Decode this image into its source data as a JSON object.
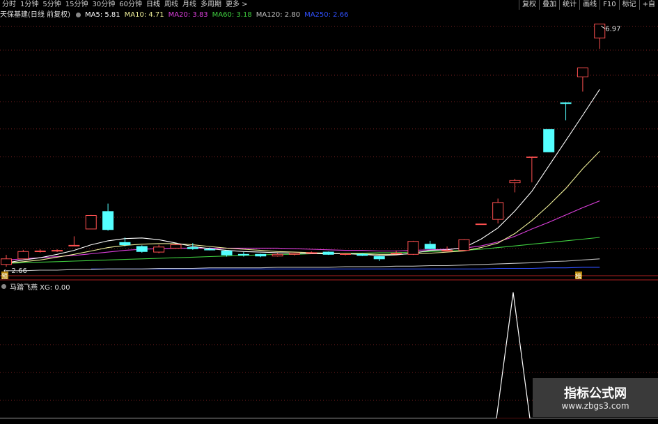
{
  "toolbar": {
    "periods": [
      "分时",
      "1分钟",
      "5分钟",
      "15分钟",
      "30分钟",
      "60分钟",
      "日线",
      "周线",
      "月线",
      "多周期",
      "更多 >"
    ],
    "active_period": "日线",
    "tools": [
      "复权",
      "叠加",
      "统计",
      "画线",
      "F10",
      "标记",
      "+自"
    ]
  },
  "legend": {
    "title": "天保基建(日线 前复权)",
    "ma5": "MA5: 5.81",
    "ma10": "MA10: 4.71",
    "ma20": "MA20: 3.83",
    "ma60": "MA60: 3.18",
    "ma120": "MA120: 2.80",
    "ma250": "MA250: 2.66"
  },
  "colors": {
    "ma5": "#ffffff",
    "ma10": "#f0f09a",
    "ma20": "#e040e0",
    "ma60": "#40d040",
    "ma120": "#c0c0c0",
    "ma250": "#3050ff",
    "up": "#ff5050",
    "down": "#54ffff",
    "grid": "#7a1f1f",
    "axis": "#b02020",
    "ind": "#ffffff"
  },
  "annotations": {
    "high_price": "6.97",
    "low_price": "2.66",
    "yu_badge": "预",
    "buy_badge": "榜"
  },
  "indicator": {
    "legend": "马踏飞燕 XG: 0.00",
    "xg_values": [
      0,
      0,
      0,
      0,
      0,
      0,
      0,
      0,
      0,
      0,
      0,
      0,
      0,
      0,
      0,
      0,
      0,
      0,
      0,
      0,
      0,
      0,
      0,
      0,
      0,
      0,
      0,
      0,
      0,
      0,
      1,
      0,
      0,
      0,
      0
    ]
  },
  "chart_data": {
    "type": "candlestick",
    "title": "天保基建(日线 前复权)",
    "ohlc": [
      {
        "o": 2.7,
        "c": 2.8,
        "h": 2.87,
        "l": 2.66
      },
      {
        "o": 2.8,
        "c": 2.93,
        "h": 2.96,
        "l": 2.8
      },
      {
        "o": 2.93,
        "c": 2.94,
        "h": 2.97,
        "l": 2.91
      },
      {
        "o": 2.94,
        "c": 2.95,
        "h": 2.97,
        "l": 2.92
      },
      {
        "o": 3.03,
        "c": 3.04,
        "h": 3.2,
        "l": 3.02
      },
      {
        "o": 3.33,
        "c": 3.57,
        "h": 3.58,
        "l": 3.33
      },
      {
        "o": 3.64,
        "c": 3.32,
        "h": 3.78,
        "l": 3.3
      },
      {
        "o": 3.09,
        "c": 3.05,
        "h": 3.18,
        "l": 3.02
      },
      {
        "o": 3.02,
        "c": 2.93,
        "h": 3.04,
        "l": 2.91
      },
      {
        "o": 2.92,
        "c": 3.01,
        "h": 3.05,
        "l": 2.9
      },
      {
        "o": 2.99,
        "c": 3.05,
        "h": 3.06,
        "l": 2.98
      },
      {
        "o": 3.0,
        "c": 2.98,
        "h": 3.08,
        "l": 2.96
      },
      {
        "o": 2.97,
        "c": 2.96,
        "h": 3.0,
        "l": 2.95
      },
      {
        "o": 2.94,
        "c": 2.87,
        "h": 2.95,
        "l": 2.84
      },
      {
        "o": 2.88,
        "c": 2.87,
        "h": 2.92,
        "l": 2.84
      },
      {
        "o": 2.88,
        "c": 2.85,
        "h": 2.89,
        "l": 2.83
      },
      {
        "o": 2.85,
        "c": 2.88,
        "h": 2.9,
        "l": 2.84
      },
      {
        "o": 2.88,
        "c": 2.9,
        "h": 2.91,
        "l": 2.86
      },
      {
        "o": 2.9,
        "c": 2.91,
        "h": 2.93,
        "l": 2.89
      },
      {
        "o": 2.92,
        "c": 2.88,
        "h": 2.93,
        "l": 2.87
      },
      {
        "o": 2.89,
        "c": 2.89,
        "h": 2.9,
        "l": 2.86
      },
      {
        "o": 2.88,
        "c": 2.86,
        "h": 2.9,
        "l": 2.85
      },
      {
        "o": 2.84,
        "c": 2.8,
        "h": 2.85,
        "l": 2.76
      },
      {
        "o": 2.89,
        "c": 2.9,
        "h": 2.95,
        "l": 2.88
      },
      {
        "o": 2.88,
        "c": 3.11,
        "h": 3.12,
        "l": 2.87
      },
      {
        "o": 3.06,
        "c": 2.98,
        "h": 3.12,
        "l": 2.97
      },
      {
        "o": 2.94,
        "c": 2.95,
        "h": 3.02,
        "l": 2.94
      },
      {
        "o": 2.95,
        "c": 3.14,
        "h": 3.15,
        "l": 2.94
      },
      {
        "o": 3.42,
        "c": 3.42,
        "h": 3.42,
        "l": 3.42
      },
      {
        "o": 3.5,
        "c": 3.8,
        "h": 3.87,
        "l": 3.43
      },
      {
        "o": 4.15,
        "c": 4.19,
        "h": 4.22,
        "l": 3.98
      },
      {
        "o": 4.6,
        "c": 4.61,
        "h": 4.61,
        "l": 4.16
      },
      {
        "o": 5.1,
        "c": 4.7,
        "h": 5.1,
        "l": 4.7
      },
      {
        "o": 5.57,
        "c": 5.56,
        "h": 5.58,
        "l": 5.26
      },
      {
        "o": 6.03,
        "c": 6.19,
        "h": 6.19,
        "l": 5.77
      },
      {
        "o": 6.72,
        "c": 6.97,
        "h": 6.97,
        "l": 6.53
      }
    ],
    "ma_lines": {
      "ma5": {
        "start": 0,
        "values": [
          2.73,
          2.78,
          2.82,
          2.88,
          2.95,
          3.05,
          3.12,
          3.16,
          3.17,
          3.14,
          3.08,
          3.02,
          2.98,
          2.95,
          2.93,
          2.92,
          2.91,
          2.9,
          2.89,
          2.89,
          2.89,
          2.88,
          2.86,
          2.87,
          2.9,
          2.95,
          2.96,
          3.0,
          3.15,
          3.35,
          3.65,
          4.0,
          4.45,
          4.9,
          5.35,
          5.81
        ]
      },
      "ma10": {
        "start": 0,
        "values": [
          2.72,
          2.75,
          2.78,
          2.83,
          2.88,
          2.94,
          3.0,
          3.04,
          3.06,
          3.07,
          3.07,
          3.05,
          3.02,
          2.99,
          2.97,
          2.95,
          2.93,
          2.92,
          2.91,
          2.9,
          2.89,
          2.89,
          2.88,
          2.88,
          2.89,
          2.9,
          2.92,
          2.94,
          3.0,
          3.08,
          3.25,
          3.48,
          3.75,
          4.05,
          4.4,
          4.71
        ]
      },
      "ma20": {
        "start": 0,
        "values": [
          2.78,
          2.8,
          2.82,
          2.84,
          2.86,
          2.89,
          2.92,
          2.95,
          2.97,
          2.98,
          2.99,
          2.99,
          2.99,
          2.99,
          2.99,
          2.99,
          2.99,
          2.98,
          2.97,
          2.96,
          2.95,
          2.95,
          2.94,
          2.94,
          2.95,
          2.96,
          2.97,
          2.99,
          3.03,
          3.1,
          3.2,
          3.33,
          3.45,
          3.58,
          3.71,
          3.83
        ]
      },
      "ma60": {
        "start": 0,
        "values": [
          2.72,
          2.73,
          2.74,
          2.75,
          2.76,
          2.77,
          2.78,
          2.79,
          2.8,
          2.81,
          2.82,
          2.83,
          2.84,
          2.85,
          2.86,
          2.87,
          2.88,
          2.88,
          2.89,
          2.89,
          2.9,
          2.9,
          2.91,
          2.91,
          2.92,
          2.93,
          2.94,
          2.95,
          2.97,
          3.0,
          3.03,
          3.06,
          3.09,
          3.12,
          3.15,
          3.18
        ]
      },
      "ma120": {
        "start": 0,
        "values": [
          2.59,
          2.59,
          2.6,
          2.6,
          2.61,
          2.61,
          2.62,
          2.62,
          2.62,
          2.63,
          2.63,
          2.63,
          2.64,
          2.64,
          2.64,
          2.64,
          2.65,
          2.65,
          2.65,
          2.65,
          2.66,
          2.66,
          2.66,
          2.67,
          2.67,
          2.68,
          2.68,
          2.69,
          2.7,
          2.71,
          2.72,
          2.73,
          2.75,
          2.76,
          2.78,
          2.8
        ]
      },
      "ma250": {
        "start": 5,
        "values": [
          2.62,
          2.62,
          2.62,
          2.62,
          2.62,
          2.62,
          2.62,
          2.62,
          2.62,
          2.62,
          2.62,
          2.62,
          2.62,
          2.62,
          2.62,
          2.62,
          2.62,
          2.62,
          2.62,
          2.62,
          2.62,
          2.62,
          2.62,
          2.62,
          2.63,
          2.63,
          2.63,
          2.64,
          2.64,
          2.65,
          2.65
        ]
      }
    },
    "ylim": [
      2.55,
      7.05
    ],
    "grid": true
  }
}
